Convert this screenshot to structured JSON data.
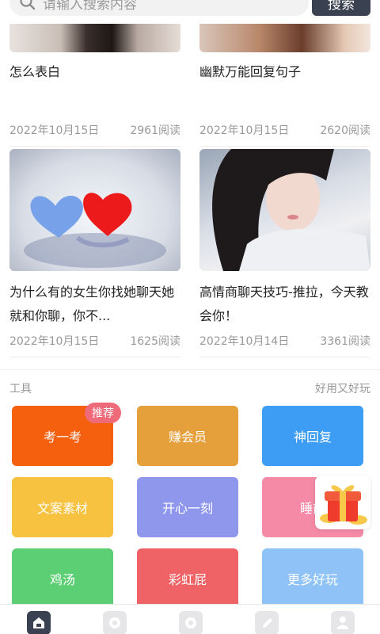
{
  "search": {
    "placeholder": "请输入搜索内容",
    "button_label": "搜索"
  },
  "articles": [
    {
      "title": "怎么表白",
      "date": "2022年10月15日",
      "reads": "2961阅读"
    },
    {
      "title": "幽默万能回复句子",
      "date": "2022年10月15日",
      "reads": "2620阅读"
    },
    {
      "title": "为什么有的女生你找她聊天她就和你聊，你不...",
      "date": "2022年10月15日",
      "reads": "1625阅读"
    },
    {
      "title": "高情商聊天技巧-推拉，今天教会你！",
      "date": "2022年10月14日",
      "reads": "3361阅读"
    }
  ],
  "tools": {
    "heading": "工具",
    "slogan": "好用又好玩",
    "badge": "推荐",
    "items": [
      {
        "label": "考一考",
        "color": "#f5600f"
      },
      {
        "label": "赚会员",
        "color": "#e59f3b"
      },
      {
        "label": "神回复",
        "color": "#3d9df5"
      },
      {
        "label": "文案素材",
        "color": "#f7c23f"
      },
      {
        "label": "开心一刻",
        "color": "#8f97ed"
      },
      {
        "label": "睡前",
        "color": "#f48aa6"
      },
      {
        "label": "鸡汤",
        "color": "#5ccf75"
      },
      {
        "label": "彩虹屁",
        "color": "#ef6265"
      },
      {
        "label": "更多好玩",
        "color": "#8fc3f7"
      }
    ]
  },
  "tabbar": {
    "icons": [
      "home-icon",
      "discover-icon",
      "chat-icon",
      "edit-icon",
      "profile-icon"
    ]
  }
}
